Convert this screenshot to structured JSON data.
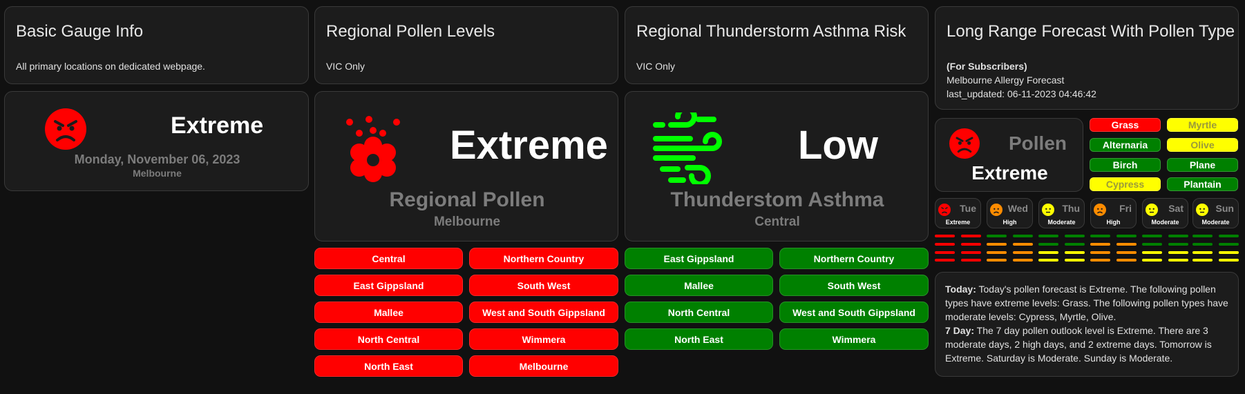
{
  "basic": {
    "title": "Basic Gauge Info",
    "subtitle": "All primary locations on dedicated webpage.",
    "level": "Extreme",
    "date": "Monday, November 06, 2023",
    "location": "Melbourne"
  },
  "pollen": {
    "title": "Regional Pollen Levels",
    "subtitle": "VIC Only",
    "level": "Extreme",
    "name": "Regional Pollen",
    "location": "Melbourne",
    "regions": [
      "Central",
      "Northern Country",
      "East Gippsland",
      "South West",
      "Mallee",
      "West and South Gippsland",
      "North Central",
      "Wimmera",
      "North East",
      "Melbourne"
    ]
  },
  "asthma": {
    "title": "Regional Thunderstorm Asthma Risk",
    "subtitle": "VIC Only",
    "level": "Low",
    "name": "Thunderstom Asthma",
    "location": "Central",
    "regions": [
      "East Gippsland",
      "Northern Country",
      "Mallee",
      "South West",
      "North Central",
      "West and South Gippsland",
      "North East",
      "Wimmera"
    ]
  },
  "forecast": {
    "title": "Long Range Forecast With Pollen Type",
    "subscribers": "(For Subscribers)",
    "name": "Melbourne Allergy Forecast",
    "updated": "last_updated: 06-11-2023 04:46:42",
    "pollen_label": "Pollen",
    "pollen_level": "Extreme",
    "types": [
      {
        "name": "Grass",
        "status": "red"
      },
      {
        "name": "Myrtle",
        "status": "yellow"
      },
      {
        "name": "Alternaria",
        "status": "green"
      },
      {
        "name": "Olive",
        "status": "yellow"
      },
      {
        "name": "Birch",
        "status": "green"
      },
      {
        "name": "Plane",
        "status": "green"
      },
      {
        "name": "Cypress",
        "status": "yellow"
      },
      {
        "name": "Plantain",
        "status": "green"
      }
    ],
    "days": [
      {
        "day": "Tue",
        "level": "Extreme",
        "color": "#ff0000",
        "bars": 4
      },
      {
        "day": "Wed",
        "level": "High",
        "color": "#ff8c00",
        "bars": 3
      },
      {
        "day": "Thu",
        "level": "Moderate",
        "color": "#ffff00",
        "bars": 2
      },
      {
        "day": "Fri",
        "level": "High",
        "color": "#ff8c00",
        "bars": 3
      },
      {
        "day": "Sat",
        "level": "Moderate",
        "color": "#ffff00",
        "bars": 2
      },
      {
        "day": "Sun",
        "level": "Moderate",
        "color": "#ffff00",
        "bars": 2
      }
    ],
    "today_label": "Today:",
    "today_text": " Today's pollen forecast is Extreme. The following pollen types have extreme levels: Grass. The following pollen types have moderate levels: Cypress, Myrtle, Olive.",
    "week_label": "7 Day:",
    "week_text": " The 7 day pollen outlook level is Extreme. There are 3 moderate days, 2 high days, and 2 extreme days. Tomorrow is Extreme. Saturday is Moderate. Sunday is Moderate."
  },
  "colors": {
    "extreme": "#ff0000",
    "high": "#ff8c00",
    "moderate": "#ffff00",
    "low": "#008000",
    "icon_green": "#00ff00"
  }
}
